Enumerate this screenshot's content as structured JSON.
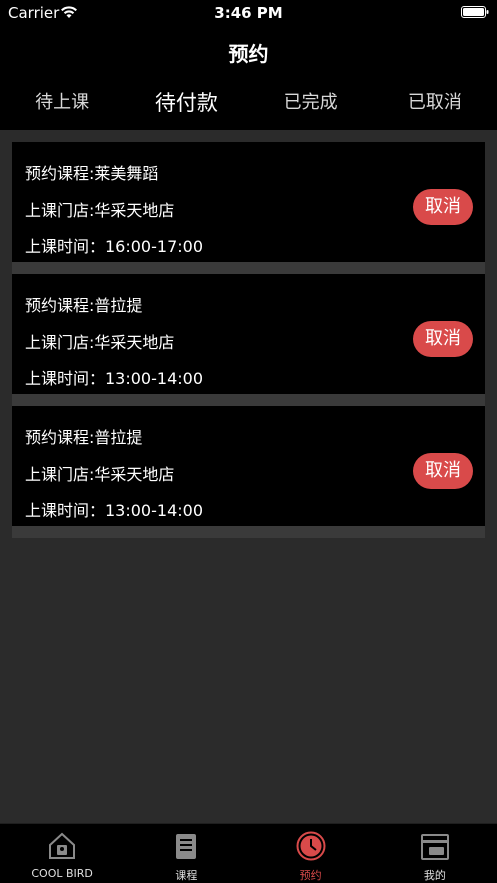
{
  "status_bar": {
    "carrier": "Carrier",
    "time": "3:46 PM"
  },
  "nav": {
    "title": "预约"
  },
  "tabs": [
    {
      "label": "待上课"
    },
    {
      "label": "待付款"
    },
    {
      "label": "已完成"
    },
    {
      "label": "已取消"
    }
  ],
  "active_tab_index": 1,
  "bookings": [
    {
      "course": "预约课程:莱美舞蹈",
      "store": "上课门店:华采天地店",
      "time": "上课时间：16:00-17:00",
      "cancel_label": "取消"
    },
    {
      "course": "预约课程:普拉提",
      "store": "上课门店:华采天地店",
      "time": "上课时间：13:00-14:00",
      "cancel_label": "取消"
    },
    {
      "course": "预约课程:普拉提",
      "store": "上课门店:华采天地店",
      "time": "上课时间：13:00-14:00",
      "cancel_label": "取消"
    }
  ],
  "tab_bar": [
    {
      "label": "COOL BIRD",
      "icon": "home-icon"
    },
    {
      "label": "课程",
      "icon": "document-icon"
    },
    {
      "label": "预约",
      "icon": "clock-icon"
    },
    {
      "label": "我的",
      "icon": "card-icon"
    }
  ],
  "active_tab_bar_index": 2,
  "colors": {
    "accent": "#d94a4a",
    "background": "#2b2b2b",
    "card": "#000000"
  }
}
